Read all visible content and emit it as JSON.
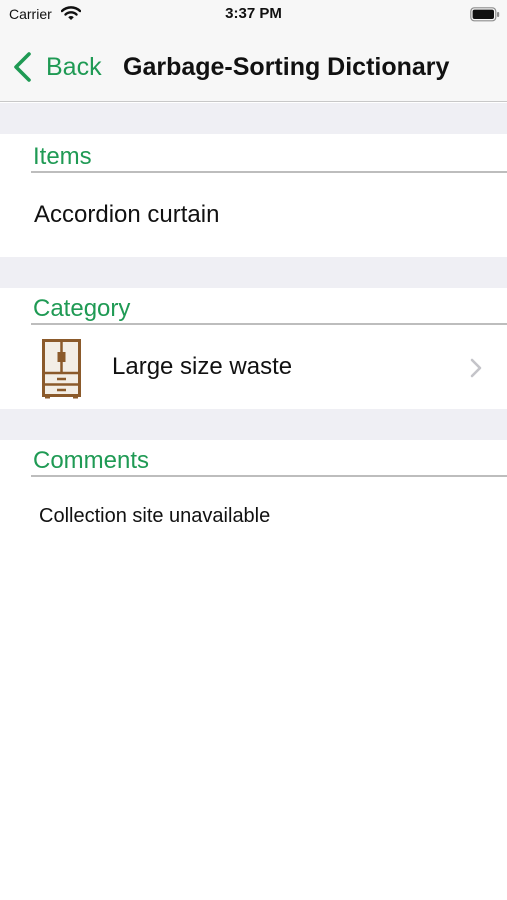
{
  "status_bar": {
    "carrier": "Carrier",
    "time": "3:37 PM",
    "icons": [
      "wifi-icon",
      "battery-icon"
    ]
  },
  "nav": {
    "back_label": "Back",
    "title": "Garbage-Sorting Dictionary",
    "icons": [
      "chevron-left-icon"
    ]
  },
  "sections": {
    "items": {
      "header": "Items",
      "value": "Accordion curtain"
    },
    "category": {
      "header": "Category",
      "value": "Large size waste",
      "icon": "cabinet-icon"
    },
    "comments": {
      "header": "Comments",
      "value": "Collection site unavailable"
    }
  },
  "colors": {
    "accent": "#1f9a54",
    "group_background": "#efeff4",
    "nav_background": "#f7f7f7",
    "icon_brown": "#8b5a2b",
    "icon_fill": "#f3eee6"
  }
}
